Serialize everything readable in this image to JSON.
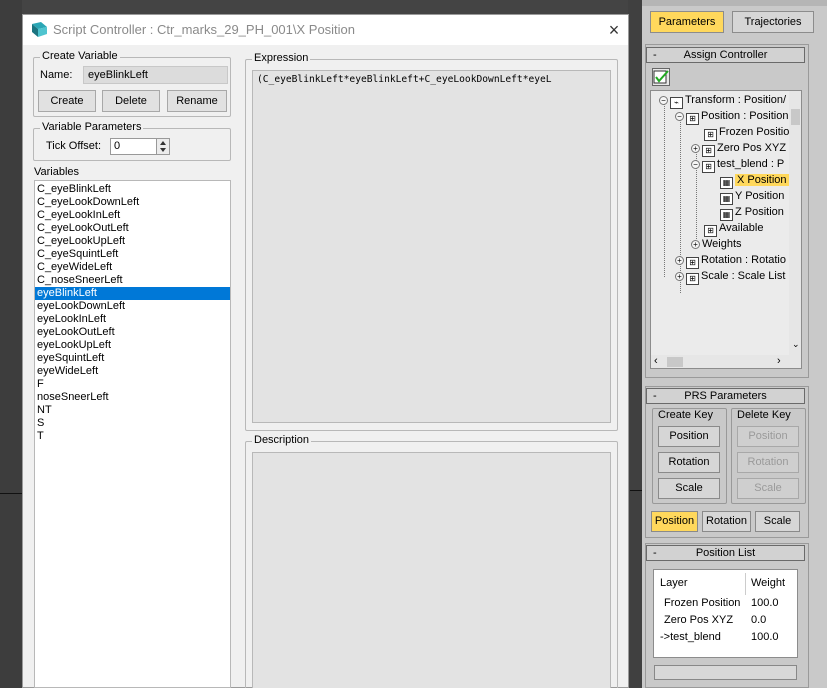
{
  "dialog": {
    "title": "Script Controller : Ctr_marks_29_PH_001\\X Position",
    "close_glyph": "×",
    "create_variable": {
      "legend": "Create Variable",
      "name_label": "Name:",
      "name_value": "eyeBlinkLeft",
      "create_label": "Create",
      "delete_label": "Delete",
      "rename_label": "Rename"
    },
    "variable_parameters": {
      "legend": "Variable Parameters",
      "tick_offset_label": "Tick Offset:",
      "tick_offset_value": "0"
    },
    "variables": {
      "label": "Variables",
      "items": [
        "C_eyeBlinkLeft",
        "C_eyeLookDownLeft",
        "C_eyeLookInLeft",
        "C_eyeLookOutLeft",
        "C_eyeLookUpLeft",
        "C_eyeSquintLeft",
        "C_eyeWideLeft",
        "C_noseSneerLeft",
        "eyeBlinkLeft",
        "eyeLookDownLeft",
        "eyeLookInLeft",
        "eyeLookOutLeft",
        "eyeLookUpLeft",
        "eyeSquintLeft",
        "eyeWideLeft",
        "F",
        "noseSneerLeft",
        "NT",
        "S",
        "T"
      ],
      "selected_index": 8
    },
    "expression": {
      "legend": "Expression",
      "text": "(C_eyeBlinkLeft*eyeBlinkLeft+C_eyeLookDownLeft*eyeL"
    },
    "description": {
      "legend": "Description",
      "text": ""
    }
  },
  "right_panel": {
    "tabs": [
      {
        "label": "Parameters",
        "active": true
      },
      {
        "label": "Trajectories",
        "active": false
      }
    ],
    "assign_controller": {
      "title": "Assign Controller",
      "tree": [
        {
          "label": "Transform : Position/",
          "level": 0,
          "selected": false
        },
        {
          "label": "Position : Position L",
          "level": 1,
          "selected": false
        },
        {
          "label": "Frozen Position",
          "level": 2,
          "selected": false
        },
        {
          "label": "Zero Pos XYZ",
          "level": 2,
          "selected": false
        },
        {
          "label": "test_blend : P",
          "level": 2,
          "selected": false
        },
        {
          "label": "X Position",
          "level": 3,
          "selected": true
        },
        {
          "label": "Y Position",
          "level": 3,
          "selected": false
        },
        {
          "label": "Z Position",
          "level": 3,
          "selected": false
        },
        {
          "label": "Available",
          "level": 2,
          "selected": false
        },
        {
          "label": "Weights",
          "level": 2,
          "selected": false
        },
        {
          "label": "Rotation : Rotatio",
          "level": 1,
          "selected": false
        },
        {
          "label": "Scale : Scale List",
          "level": 1,
          "selected": false
        }
      ]
    },
    "prs_parameters": {
      "title": "PRS Parameters",
      "create_key_label": "Create Key",
      "delete_key_label": "Delete Key",
      "create_buttons": [
        "Position",
        "Rotation",
        "Scale"
      ],
      "delete_buttons": [
        "Position",
        "Rotation",
        "Scale"
      ],
      "bottom_buttons": [
        {
          "label": "Position",
          "active": true
        },
        {
          "label": "Rotation",
          "active": false
        },
        {
          "label": "Scale",
          "active": false
        }
      ]
    },
    "position_list": {
      "title": "Position List",
      "col_layer": "Layer",
      "col_weight": "Weight",
      "rows": [
        {
          "layer": "Frozen Position",
          "weight": "100.0"
        },
        {
          "layer": "Zero Pos XYZ",
          "weight": "0.0"
        },
        {
          "layer": "->test_blend",
          "weight": "100.0"
        }
      ]
    },
    "collapse_glyph": "-"
  }
}
